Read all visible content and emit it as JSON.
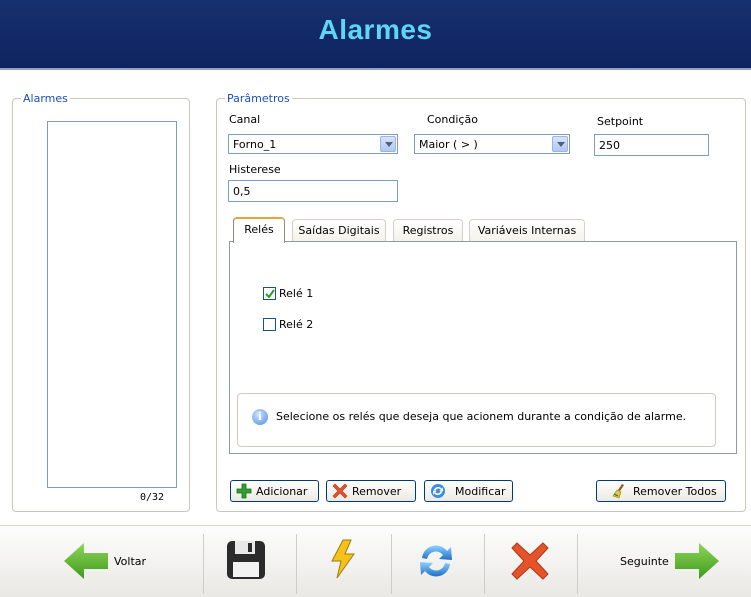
{
  "header": {
    "title": "Alarmes"
  },
  "alarmes": {
    "legend": "Alarmes",
    "counter": "0/32"
  },
  "parametros": {
    "legend": "Parâmetros",
    "canal": {
      "label": "Canal",
      "value": "Forno_1"
    },
    "condicao": {
      "label": "Condição",
      "value": "Maior ( > )"
    },
    "setpoint": {
      "label": "Setpoint",
      "value": "250"
    },
    "histerese": {
      "label": "Histerese",
      "value": "0,5"
    }
  },
  "tabs": [
    {
      "label": "Relés",
      "active": true
    },
    {
      "label": "Saídas Digitais",
      "active": false
    },
    {
      "label": "Registros",
      "active": false
    },
    {
      "label": "Variáveis Internas",
      "active": false
    }
  ],
  "reles": [
    {
      "label": "Relé 1",
      "checked": true
    },
    {
      "label": "Relé 2",
      "checked": false
    }
  ],
  "info": {
    "text": "Selecione os relés que deseja que acionem durante a condição de alarme."
  },
  "actions": {
    "adicionar": "Adicionar",
    "remover": "Remover",
    "modificar": "Modificar",
    "remover_todos": "Remover Todos"
  },
  "footer": {
    "voltar": "Voltar",
    "seguinte": "Seguinte",
    "icons": [
      "arrow-left-icon",
      "save-icon",
      "lightning-icon",
      "refresh-icon",
      "close-icon",
      "arrow-right-icon"
    ]
  },
  "colors": {
    "header_bg": "#17306f",
    "title": "#5ed6f6",
    "legend": "#1b4fbf",
    "green_arrow": "#58b42a",
    "red_x": "#e4532a"
  }
}
